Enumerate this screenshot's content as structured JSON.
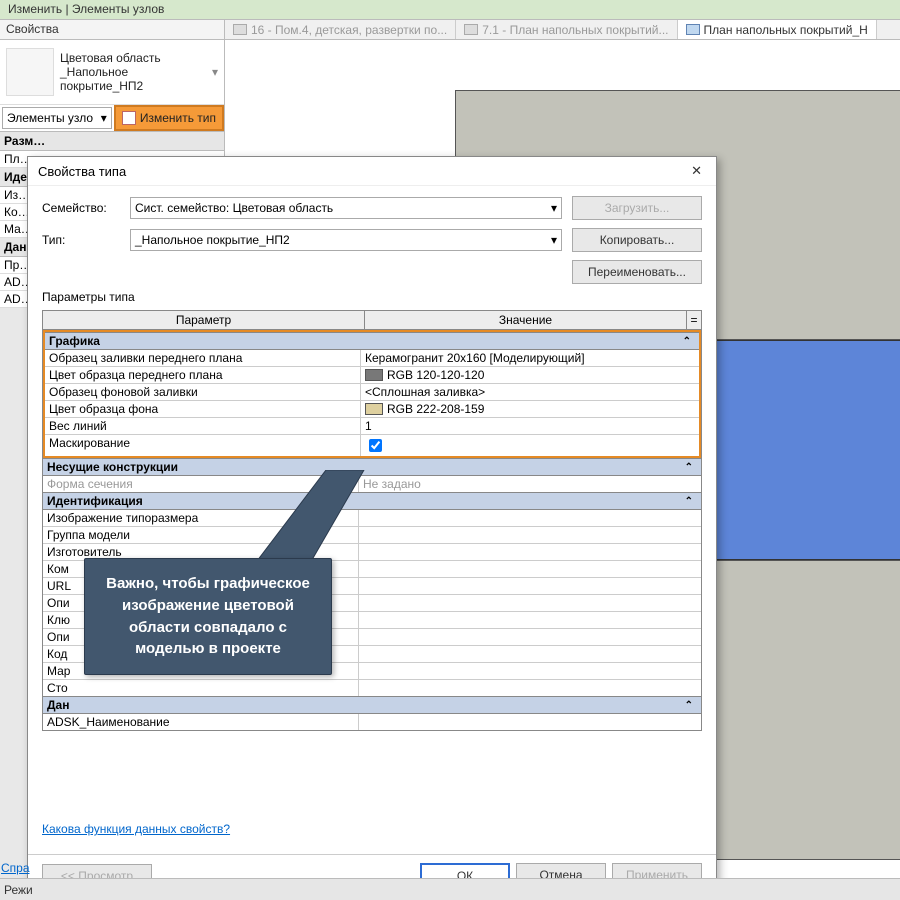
{
  "ribbon": {
    "title": "Изменить | Элементы узлов"
  },
  "properties_panel": {
    "header": "Свойства",
    "type_line1": "Цветовая область",
    "type_line2": "_Напольное",
    "type_line3": "покрытие_НП2",
    "selector_label": "Элементы узло",
    "edit_type_btn": "Изменить тип",
    "sections": [
      {
        "header": "Разм…",
        "rows": [
          "Пл…"
        ]
      },
      {
        "header": "Иде…",
        "rows": [
          "Из…",
          "Ко…",
          "Ма…"
        ]
      },
      {
        "header": "Дан…",
        "rows": [
          "Пр…",
          "AD…",
          "AD…"
        ]
      }
    ]
  },
  "tabs": [
    {
      "label": "16 - Пом.4, детская, развертки по...",
      "active": false
    },
    {
      "label": "7.1 - План напольных покрытий...",
      "active": false
    },
    {
      "label": "План напольных покрытий_Н",
      "active": true
    }
  ],
  "dialog": {
    "title": "Свойства типа",
    "family_label": "Семейство:",
    "family_value": "Сист. семейство: Цветовая область",
    "type_label": "Тип:",
    "type_value": "_Напольное покрытие_НП2",
    "btn_load": "Загрузить...",
    "btn_duplicate": "Копировать...",
    "btn_rename": "Переименовать...",
    "params_label": "Параметры типа",
    "col_param": "Параметр",
    "col_value": "Значение",
    "col_eq": "=",
    "groups": [
      {
        "name": "Графика",
        "highlighted": true,
        "rows": [
          {
            "param": "Образец заливки переднего плана",
            "value": "Керамогранит 20х160 [Моделирующий]",
            "type": "text"
          },
          {
            "param": "Цвет образца переднего плана",
            "value": "RGB 120-120-120",
            "type": "color",
            "swatch": "#787878"
          },
          {
            "param": "Образец фоновой заливки",
            "value": "<Сплошная заливка>",
            "type": "text"
          },
          {
            "param": "Цвет образца фона",
            "value": "RGB 222-208-159",
            "type": "color",
            "swatch": "#ded09f"
          },
          {
            "param": "Вес линий",
            "value": "1",
            "type": "text"
          },
          {
            "param": "Маскирование",
            "value": "",
            "type": "check",
            "checked": true
          }
        ]
      },
      {
        "name": "Несущие конструкции",
        "rows": [
          {
            "param": "Форма сечения",
            "value": "Не задано",
            "muted": true
          }
        ]
      },
      {
        "name": "Идентификация",
        "rows": [
          {
            "param": "Изображение типоразмера",
            "value": ""
          },
          {
            "param": "Группа модели",
            "value": ""
          },
          {
            "param": "Изготовитель",
            "value": ""
          },
          {
            "param": "Ком",
            "value": ""
          },
          {
            "param": "URL",
            "value": ""
          },
          {
            "param": "Опи",
            "value": ""
          },
          {
            "param": "Клю",
            "value": ""
          },
          {
            "param": "Опи",
            "value": ""
          },
          {
            "param": "Код",
            "value": ""
          },
          {
            "param": "Мар",
            "value": ""
          },
          {
            "param": "Сто",
            "value": ""
          }
        ]
      },
      {
        "name": "Дан",
        "rows": [
          {
            "param": "ADSK_Наименование",
            "value": ""
          }
        ]
      }
    ],
    "help_link": "Какова функция данных свойств?",
    "preview_btn": "<< Просмотр",
    "ok_btn": "ОК",
    "cancel_btn": "Отмена",
    "apply_btn": "Применить"
  },
  "callout_text": "Важно, чтобы графическое изображение цветовой области совпадало с моделью в проекте",
  "bottom": {
    "help": "Спра",
    "mode": "Режи"
  }
}
